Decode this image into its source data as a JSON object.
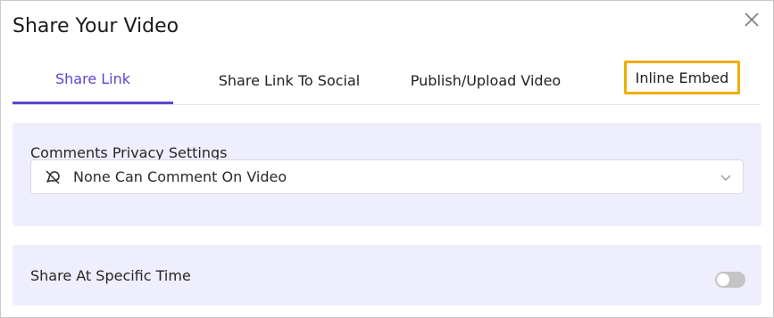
{
  "dialog": {
    "title": "Share Your Video"
  },
  "tabs": [
    {
      "label": "Share Link",
      "active": true
    },
    {
      "label": "Share Link To Social",
      "active": false
    },
    {
      "label": "Publish/Upload Video",
      "active": false
    },
    {
      "label": "Inline Embed",
      "active": false,
      "highlighted": true
    }
  ],
  "comments_privacy": {
    "label": "Comments Privacy Settings",
    "selected_value": "None Can Comment On Video",
    "icon": "no-comment-icon"
  },
  "share_at_time": {
    "label": "Share At Specific Time",
    "enabled": false
  },
  "colors": {
    "accent": "#5747d0",
    "highlight_border": "#f0ad00",
    "panel_bg": "#efeefc"
  }
}
